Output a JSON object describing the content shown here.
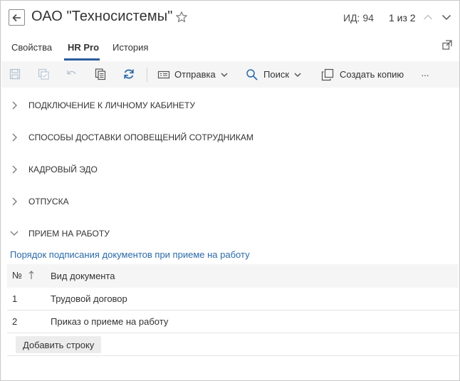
{
  "header": {
    "title": "ОАО \"Техносистемы\"",
    "id_label": "ИД: 94",
    "pager": "1 из 2"
  },
  "tabs": [
    {
      "label": "Свойства",
      "active": false
    },
    {
      "label": "HR Pro",
      "active": true
    },
    {
      "label": "История",
      "active": false
    }
  ],
  "toolbar": {
    "send_label": "Отправка",
    "search_label": "Поиск",
    "copy_label": "Создать копию",
    "more_label": "···"
  },
  "sections": [
    {
      "label": "ПОДКЛЮЧЕНИЕ К ЛИЧНОМУ КАБИНЕТУ",
      "expanded": false
    },
    {
      "label": "СПОСОБЫ ДОСТАВКИ ОПОВЕЩЕНИЙ СОТРУДНИКАМ",
      "expanded": false
    },
    {
      "label": "КАДРОВЫЙ ЭДО",
      "expanded": false
    },
    {
      "label": "ОТПУСКА",
      "expanded": false
    },
    {
      "label": "ПРИЕМ НА РАБОТУ",
      "expanded": true
    }
  ],
  "hiring": {
    "link": "Порядок подписания документов при приеме на работу",
    "columns": {
      "num": "№",
      "doc": "Вид документа"
    },
    "rows": [
      {
        "num": "1",
        "doc": "Трудовой договор"
      },
      {
        "num": "2",
        "doc": "Приказ о приеме на работу"
      }
    ],
    "add_label": "Добавить строку"
  },
  "colors": {
    "accent": "#2b5a9b",
    "link": "#2b6aa9",
    "refresh_icon": "#2b6aa9",
    "disabled_icon": "#b8c4d4"
  }
}
